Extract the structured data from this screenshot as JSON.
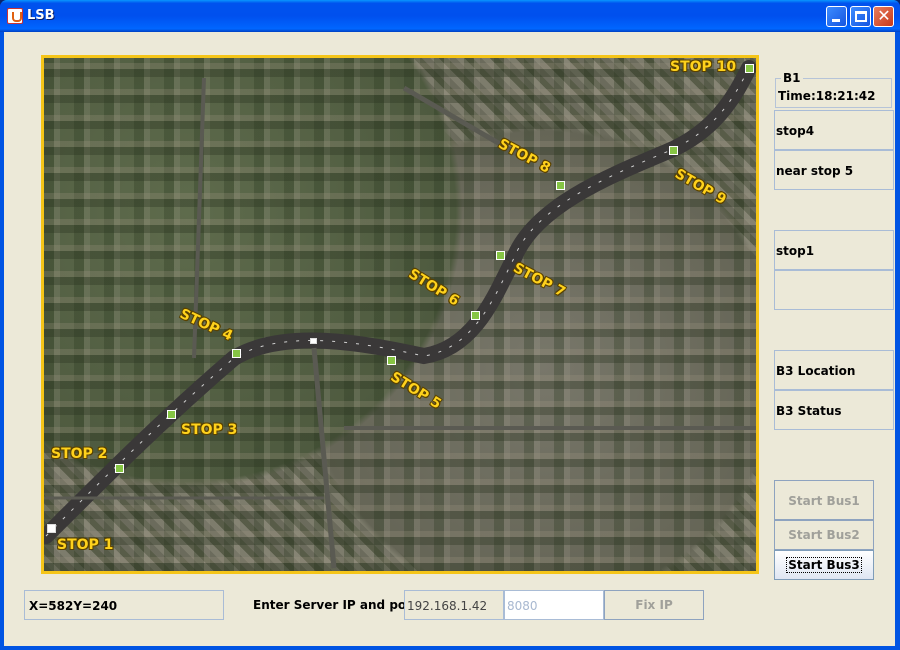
{
  "window": {
    "title": "LSB"
  },
  "map": {
    "stops": [
      {
        "label": "STOP 1"
      },
      {
        "label": "STOP 2"
      },
      {
        "label": "STOP 3"
      },
      {
        "label": "STOP 4"
      },
      {
        "label": "STOP 5"
      },
      {
        "label": "STOP 6"
      },
      {
        "label": "STOP 7"
      },
      {
        "label": "STOP 8"
      },
      {
        "label": "STOP 9"
      },
      {
        "label": "STOP 10"
      }
    ]
  },
  "sidebar": {
    "b1": {
      "legend": "B1",
      "time": "Time:18:21:42"
    },
    "bus1_location": "stop4",
    "bus1_status": "near stop 5",
    "bus2_location": "stop1",
    "bus2_status": "",
    "bus3_location": "B3 Location",
    "bus3_status": "B3 Status",
    "buttons": {
      "start_bus1": "Start Bus1",
      "start_bus2": "Start Bus2",
      "start_bus3": "Start Bus3"
    }
  },
  "footer": {
    "coordinates": "X=582Y=240",
    "server_label": "Enter Server IP and port:",
    "ip_value": "192.168.1.42",
    "port_value": "8080",
    "fix_ip": "Fix IP"
  }
}
